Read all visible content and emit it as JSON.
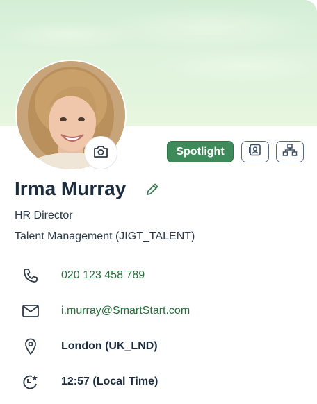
{
  "profile": {
    "name": "Irma Murray",
    "job_title": "HR Director",
    "department": "Talent Management (JIGT_TALENT)"
  },
  "actions": {
    "spotlight_label": "Spotlight",
    "contact_card_icon": "contact-card-icon",
    "org_chart_icon": "org-chart-icon",
    "camera_icon": "camera-icon",
    "edit_icon": "pencil-icon"
  },
  "contact": {
    "phone": "020 123 458 789",
    "email": "i.murray@SmartStart.com",
    "location": "London (UK_LND)",
    "local_time": "12:57 (Local Time)"
  },
  "colors": {
    "accent_green": "#3f8a5a",
    "link_green": "#256f3a",
    "text_dark": "#1d2d3e"
  }
}
